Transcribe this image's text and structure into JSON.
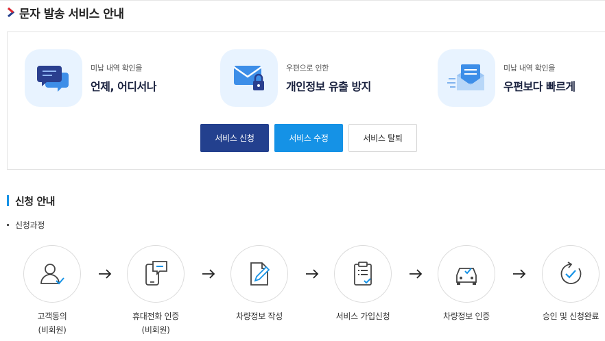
{
  "page": {
    "title": "문자 발송 서비스 안내"
  },
  "features": [
    {
      "icon": "chat-bubbles-icon",
      "sub": "미납 내역 확인을",
      "main": "언제, 어디서나"
    },
    {
      "icon": "mail-lock-icon",
      "sub": "우편으로 인한",
      "main": "개인정보 유출 방지"
    },
    {
      "icon": "fast-mail-icon",
      "sub": "미납 내역 확인을",
      "main": "우편보다 빠르게"
    }
  ],
  "buttons": {
    "apply": "서비스 신청",
    "edit": "서비스 수정",
    "cancel": "서비스 탈퇴"
  },
  "section": {
    "title": "신청 안내",
    "process_label": "신청과정"
  },
  "steps": [
    {
      "icon": "user-check-icon",
      "line1": "고객동의",
      "line2": "(비회원)"
    },
    {
      "icon": "phone-message-icon",
      "line1": "휴대전화 인증",
      "line2": "(비회원)"
    },
    {
      "icon": "document-edit-icon",
      "line1": "차량정보 작성",
      "line2": ""
    },
    {
      "icon": "clipboard-check-icon",
      "line1": "서비스 가입신청",
      "line2": ""
    },
    {
      "icon": "car-check-icon",
      "line1": "차량정보 인증",
      "line2": ""
    },
    {
      "icon": "circle-check-icon",
      "line1": "승인 및 신청완료",
      "line2": ""
    }
  ],
  "colors": {
    "primary": "#23408e",
    "accent": "#1592e6",
    "title_chevron": "#e5262c",
    "icon_bg": "#e8f3ff"
  }
}
